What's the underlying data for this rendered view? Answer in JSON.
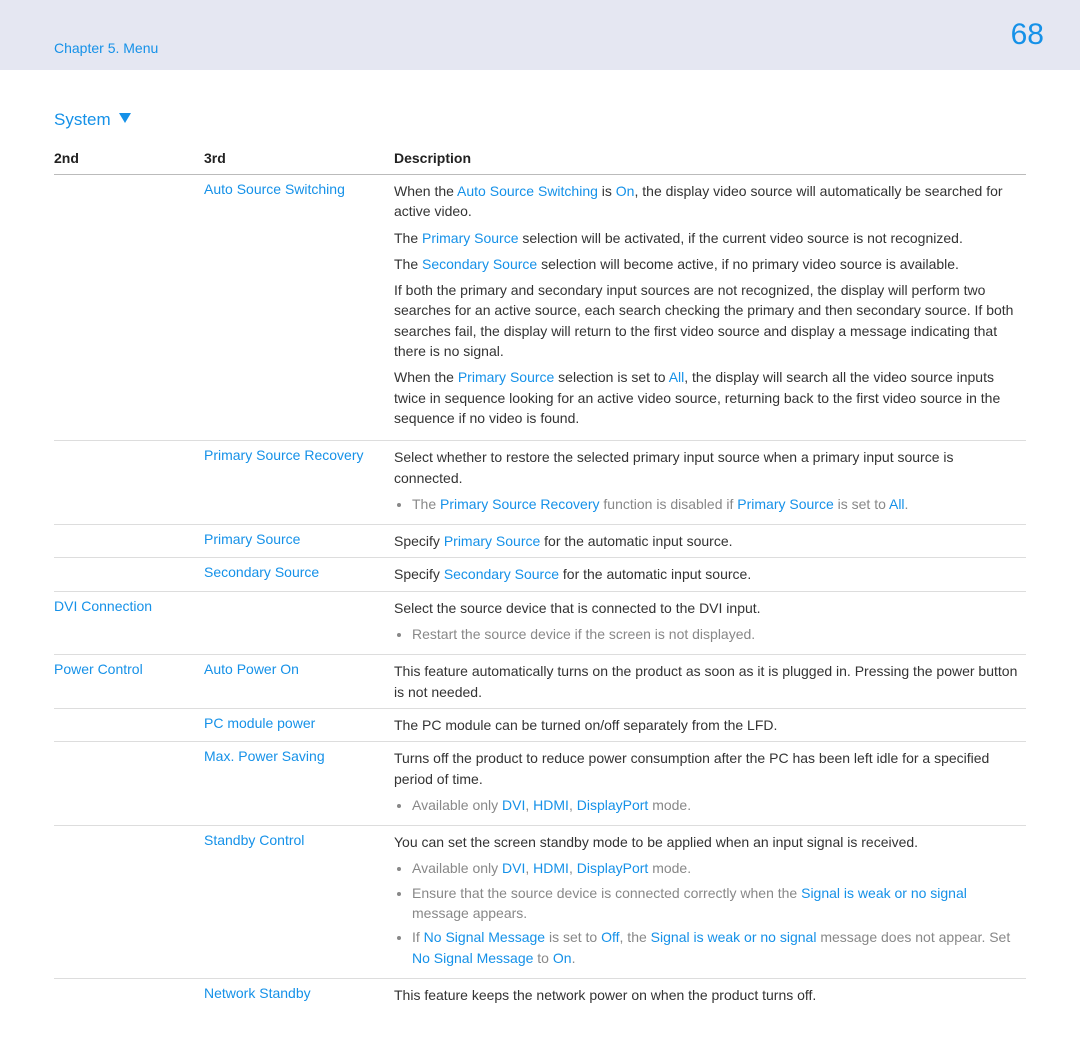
{
  "header": {
    "chapter": "Chapter 5. Menu",
    "page_number": "68"
  },
  "section": {
    "title": "System"
  },
  "columns": {
    "col1": "2nd",
    "col2": "3rd",
    "col3": "Description"
  },
  "rows": {
    "r1": {
      "second": "",
      "third": "Auto Source Switching",
      "p1_a": "When the ",
      "p1_b": "Auto Source Switching",
      "p1_c": " is ",
      "p1_d": "On",
      "p1_e": ", the display video source will automatically be searched for active video.",
      "p2_a": "The ",
      "p2_b": "Primary Source",
      "p2_c": " selection will be activated, if the current video source is not recognized.",
      "p3_a": "The ",
      "p3_b": "Secondary Source",
      "p3_c": " selection will become active, if no primary video source is available.",
      "p4": "If both the primary and secondary input sources are not recognized, the display will perform two searches for an active source, each search checking the primary and then secondary source. If both searches fail, the display will return to the first video source and display a message indicating that there is no signal.",
      "p5_a": "When the ",
      "p5_b": "Primary Source",
      "p5_c": " selection is set to ",
      "p5_d": "All",
      "p5_e": ", the display will search all the video source inputs twice in sequence looking for an active video source, returning back to the first video source in the sequence if no video is found."
    },
    "r2": {
      "third": "Primary Source Recovery",
      "p1": "Select whether to restore the selected primary input source when a primary input source is connected.",
      "n1_a": "The ",
      "n1_b": "Primary Source Recovery",
      "n1_c": " function is disabled if ",
      "n1_d": "Primary Source",
      "n1_e": " is set to ",
      "n1_f": "All",
      "n1_g": "."
    },
    "r3": {
      "third": "Primary Source",
      "p_a": "Specify ",
      "p_b": "Primary Source",
      "p_c": " for the automatic input source."
    },
    "r4": {
      "third": "Secondary Source",
      "p_a": "Specify ",
      "p_b": "Secondary Source",
      "p_c": " for the automatic input source."
    },
    "r5": {
      "second": "DVI Connection",
      "p": "Select the source device that is connected to the DVI input.",
      "n": "Restart the source device if the screen is not displayed."
    },
    "r6": {
      "second": "Power Control",
      "third": "Auto Power On",
      "p": "This feature automatically turns on the product as soon as it is plugged in. Pressing the power button is not needed."
    },
    "r7": {
      "third": "PC module power",
      "p": "The PC module can be turned on/off separately from the LFD."
    },
    "r8": {
      "third": "Max. Power Saving",
      "p": "Turns off the product to reduce power consumption after the PC has been left idle for a specified period of time.",
      "n_a": "Available only ",
      "n_b": "DVI",
      "n_c": ", ",
      "n_d": "HDMI",
      "n_e": ", ",
      "n_f": "DisplayPort",
      "n_g": " mode."
    },
    "r9": {
      "third": "Standby Control",
      "p": "You can set the screen standby mode to be applied when an input signal is received.",
      "b1_a": "Available only ",
      "b1_b": "DVI",
      "b1_c": ", ",
      "b1_d": "HDMI",
      "b1_e": ", ",
      "b1_f": "DisplayPort",
      "b1_g": " mode.",
      "b2_a": "Ensure that the source device is connected correctly when the ",
      "b2_b": "Signal is weak or no signal",
      "b2_c": " message appears.",
      "b3_a": "If ",
      "b3_b": "No Signal Message",
      "b3_c": " is set to ",
      "b3_d": "Off",
      "b3_e": ", the ",
      "b3_f": "Signal is weak or no signal",
      "b3_g": " message does not appear. Set ",
      "b3_h": "No Signal Message",
      "b3_i": " to ",
      "b3_j": "On",
      "b3_k": "."
    },
    "r10": {
      "third": "Network Standby",
      "p": "This feature keeps the network power on when the product turns off."
    }
  }
}
